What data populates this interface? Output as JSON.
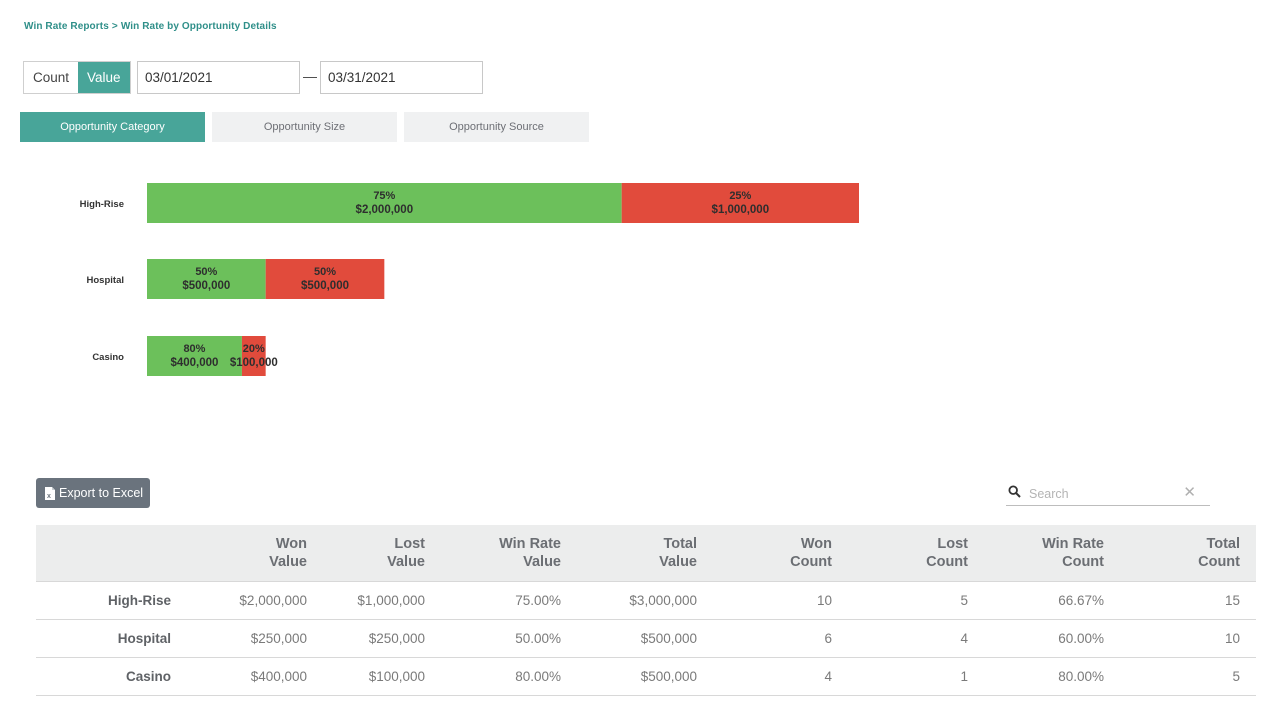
{
  "breadcrumb": {
    "items": [
      "Win Rate Reports",
      "Win Rate by Opportunity Details"
    ],
    "separator": ">"
  },
  "mode_toggle": {
    "options": [
      "Count",
      "Value"
    ],
    "selected": "Value"
  },
  "date_range": {
    "start": "03/01/2021",
    "end": "03/31/2021",
    "separator": "—"
  },
  "tabs": [
    {
      "label": "Opportunity Category",
      "active": true
    },
    {
      "label": "Opportunity Size",
      "active": false
    },
    {
      "label": "Opportunity Source",
      "active": false
    }
  ],
  "colors": {
    "accent": "#48a599",
    "won": "#6cc05b",
    "lost": "#e14b3c",
    "breadcrumb": "#2f8f89"
  },
  "chart_data": {
    "type": "bar",
    "orientation": "horizontal",
    "stacked": true,
    "categories": [
      "High-Rise",
      "Hospital",
      "Casino"
    ],
    "series": [
      {
        "name": "Won",
        "values": [
          2000000,
          500000,
          400000
        ],
        "percent_labels": [
          "75%",
          "50%",
          "80%"
        ],
        "value_labels": [
          "$2,000,000",
          "$500,000",
          "$400,000"
        ],
        "color": "#6cc05b"
      },
      {
        "name": "Lost",
        "values": [
          1000000,
          500000,
          100000
        ],
        "percent_labels": [
          "25%",
          "50%",
          "20%"
        ],
        "value_labels": [
          "$1,000,000",
          "$500,000",
          "$100,000"
        ],
        "color": "#e14b3c"
      }
    ],
    "title": "",
    "xlabel": "",
    "ylabel": "",
    "xlim": [
      0,
      4500000
    ],
    "grid": false,
    "legend": "none"
  },
  "toolbar": {
    "export_label": "Export to Excel",
    "search_placeholder": "Search",
    "search_value": ""
  },
  "table": {
    "headers": [
      [
        "",
        ""
      ],
      [
        "Won",
        "Value"
      ],
      [
        "Lost",
        "Value"
      ],
      [
        "Win Rate",
        "Value"
      ],
      [
        "Total",
        "Value"
      ],
      [
        "Won",
        "Count"
      ],
      [
        "Lost",
        "Count"
      ],
      [
        "Win Rate",
        "Count"
      ],
      [
        "Total",
        "Count"
      ]
    ],
    "rows": [
      [
        "High-Rise",
        "$2,000,000",
        "$1,000,000",
        "75.00%",
        "$3,000,000",
        "10",
        "5",
        "66.67%",
        "15"
      ],
      [
        "Hospital",
        "$250,000",
        "$250,000",
        "50.00%",
        "$500,000",
        "6",
        "4",
        "60.00%",
        "10"
      ],
      [
        "Casino",
        "$400,000",
        "$100,000",
        "80.00%",
        "$500,000",
        "4",
        "1",
        "80.00%",
        "5"
      ]
    ]
  }
}
